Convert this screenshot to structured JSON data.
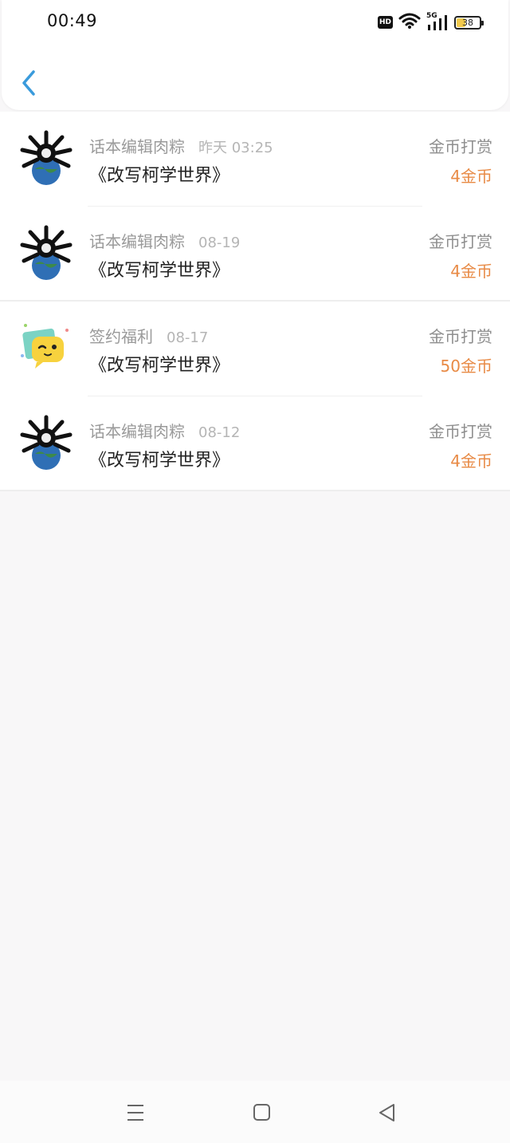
{
  "status_bar": {
    "time": "00:49",
    "hd_label": "HD",
    "network_label": "5G",
    "battery_level": "38"
  },
  "colors": {
    "accent": "#3a9bdc",
    "amount": "#e88a45"
  },
  "records": [
    {
      "name": "话本编辑肉粽",
      "time": "昨天 03:25",
      "title": "《改写柯学世界》",
      "type": "金币打赏",
      "amount": "4金币",
      "avatar": "globe-spider-avatar"
    },
    {
      "name": "话本编辑肉粽",
      "time": "08-19",
      "title": "《改写柯学世界》",
      "type": "金币打赏",
      "amount": "4金币",
      "avatar": "globe-spider-avatar"
    },
    {
      "name": "签约福利",
      "time": "08-17",
      "title": "《改写柯学世界》",
      "type": "金币打赏",
      "amount": "50金币",
      "avatar": "wink-chat-bubble-avatar"
    },
    {
      "name": "话本编辑肉粽",
      "time": "08-12",
      "title": "《改写柯学世界》",
      "type": "金币打赏",
      "amount": "4金币",
      "avatar": "globe-spider-avatar"
    }
  ],
  "nav_icons": [
    "menu-icon",
    "home-icon",
    "back-triangle-icon"
  ]
}
